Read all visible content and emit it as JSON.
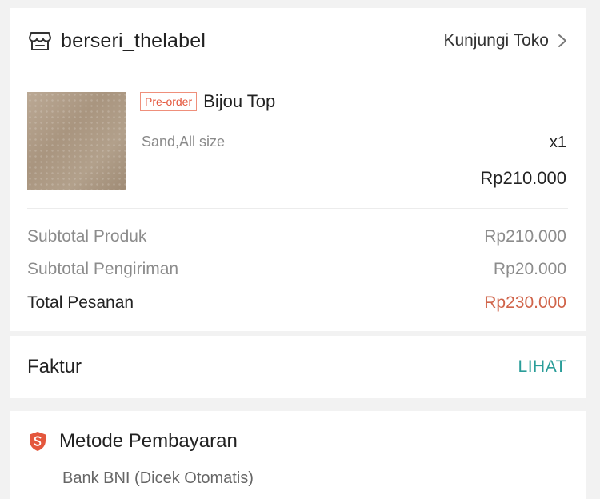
{
  "shop": {
    "name": "berseri_thelabel",
    "visit_label": "Kunjungi Toko"
  },
  "product": {
    "badge": "Pre-order",
    "name": "Bijou Top",
    "variant": "Sand,All size",
    "quantity": "x1",
    "price": "Rp210.000"
  },
  "summary": {
    "rows": [
      {
        "label": "Subtotal Produk",
        "value": "Rp210.000"
      },
      {
        "label": "Subtotal Pengiriman",
        "value": "Rp20.000"
      },
      {
        "label": "Total Pesanan",
        "value": "Rp230.000"
      }
    ]
  },
  "invoice": {
    "label": "Faktur",
    "link": "LIHAT"
  },
  "payment": {
    "title": "Metode Pembayaran",
    "method": "Bank BNI (Dicek Otomatis)"
  },
  "colors": {
    "accent_orange": "#d0644a",
    "link_teal": "#2a9d99",
    "badge_red": "#e4573d"
  },
  "icons": {
    "shop": "store-icon",
    "chevron": "chevron-right-icon",
    "payment": "shield-payment-icon"
  }
}
